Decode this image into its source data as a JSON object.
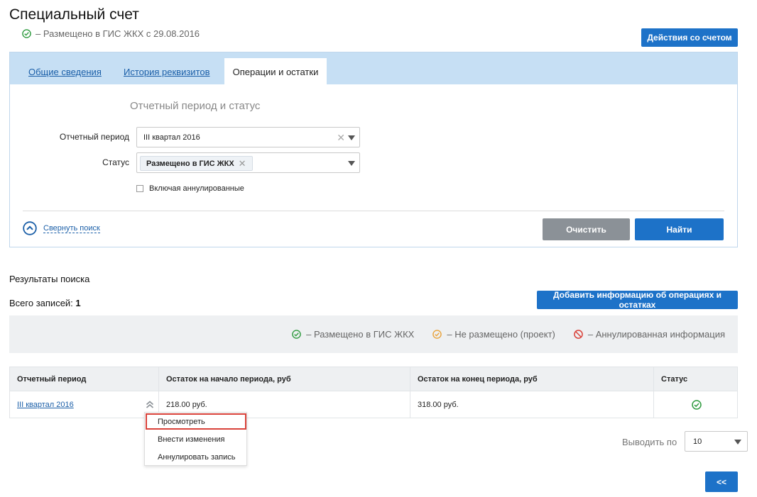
{
  "page": {
    "title": "Специальный счет",
    "status_text": "–  Размещено в ГИС ЖКХ с 29.08.2016",
    "actions_button": "Действия со счетом"
  },
  "tabs": [
    {
      "label": "Общие сведения",
      "active": false
    },
    {
      "label": "История реквизитов",
      "active": false
    },
    {
      "label": "Операции и остатки",
      "active": true
    }
  ],
  "search": {
    "section_title": "Отчетный период и статус",
    "period_label": "Отчетный период",
    "period_value": "III квартал 2016",
    "status_label": "Статус",
    "status_chip": "Размещено в ГИС ЖКХ",
    "include_cancelled_label": "Включая аннулированные",
    "collapse_label": "Свернуть поиск",
    "clear_button": "Очистить",
    "find_button": "Найти"
  },
  "results": {
    "title": "Результаты поиска",
    "total_label": "Всего записей:",
    "total_count": "1",
    "add_button": "Добавить информацию об операциях и остатках"
  },
  "legend": {
    "placed": "–  Размещено в ГИС ЖКХ",
    "not_placed": "–  Не размещено (проект)",
    "cancelled": "–  Аннулированная информация",
    "colors": {
      "placed": "#2e9a3e",
      "not_placed": "#e8a23a",
      "cancelled": "#d9423a"
    }
  },
  "table": {
    "headers": [
      "Отчетный период",
      "Остаток на начало периода, руб",
      "Остаток на конец периода, руб",
      "Статус"
    ],
    "rows": [
      {
        "period": "III квартал 2016",
        "start_balance": "218.00 руб.",
        "end_balance": "318.00 руб.",
        "status": "placed"
      }
    ]
  },
  "row_menu": {
    "items": [
      "Просмотреть",
      "Внести изменения",
      "Аннулировать запись"
    ],
    "highlighted": "Просмотреть"
  },
  "pagination": {
    "page_size_label": "Выводить по",
    "page_size_value": "10",
    "prev_button": "<<"
  }
}
